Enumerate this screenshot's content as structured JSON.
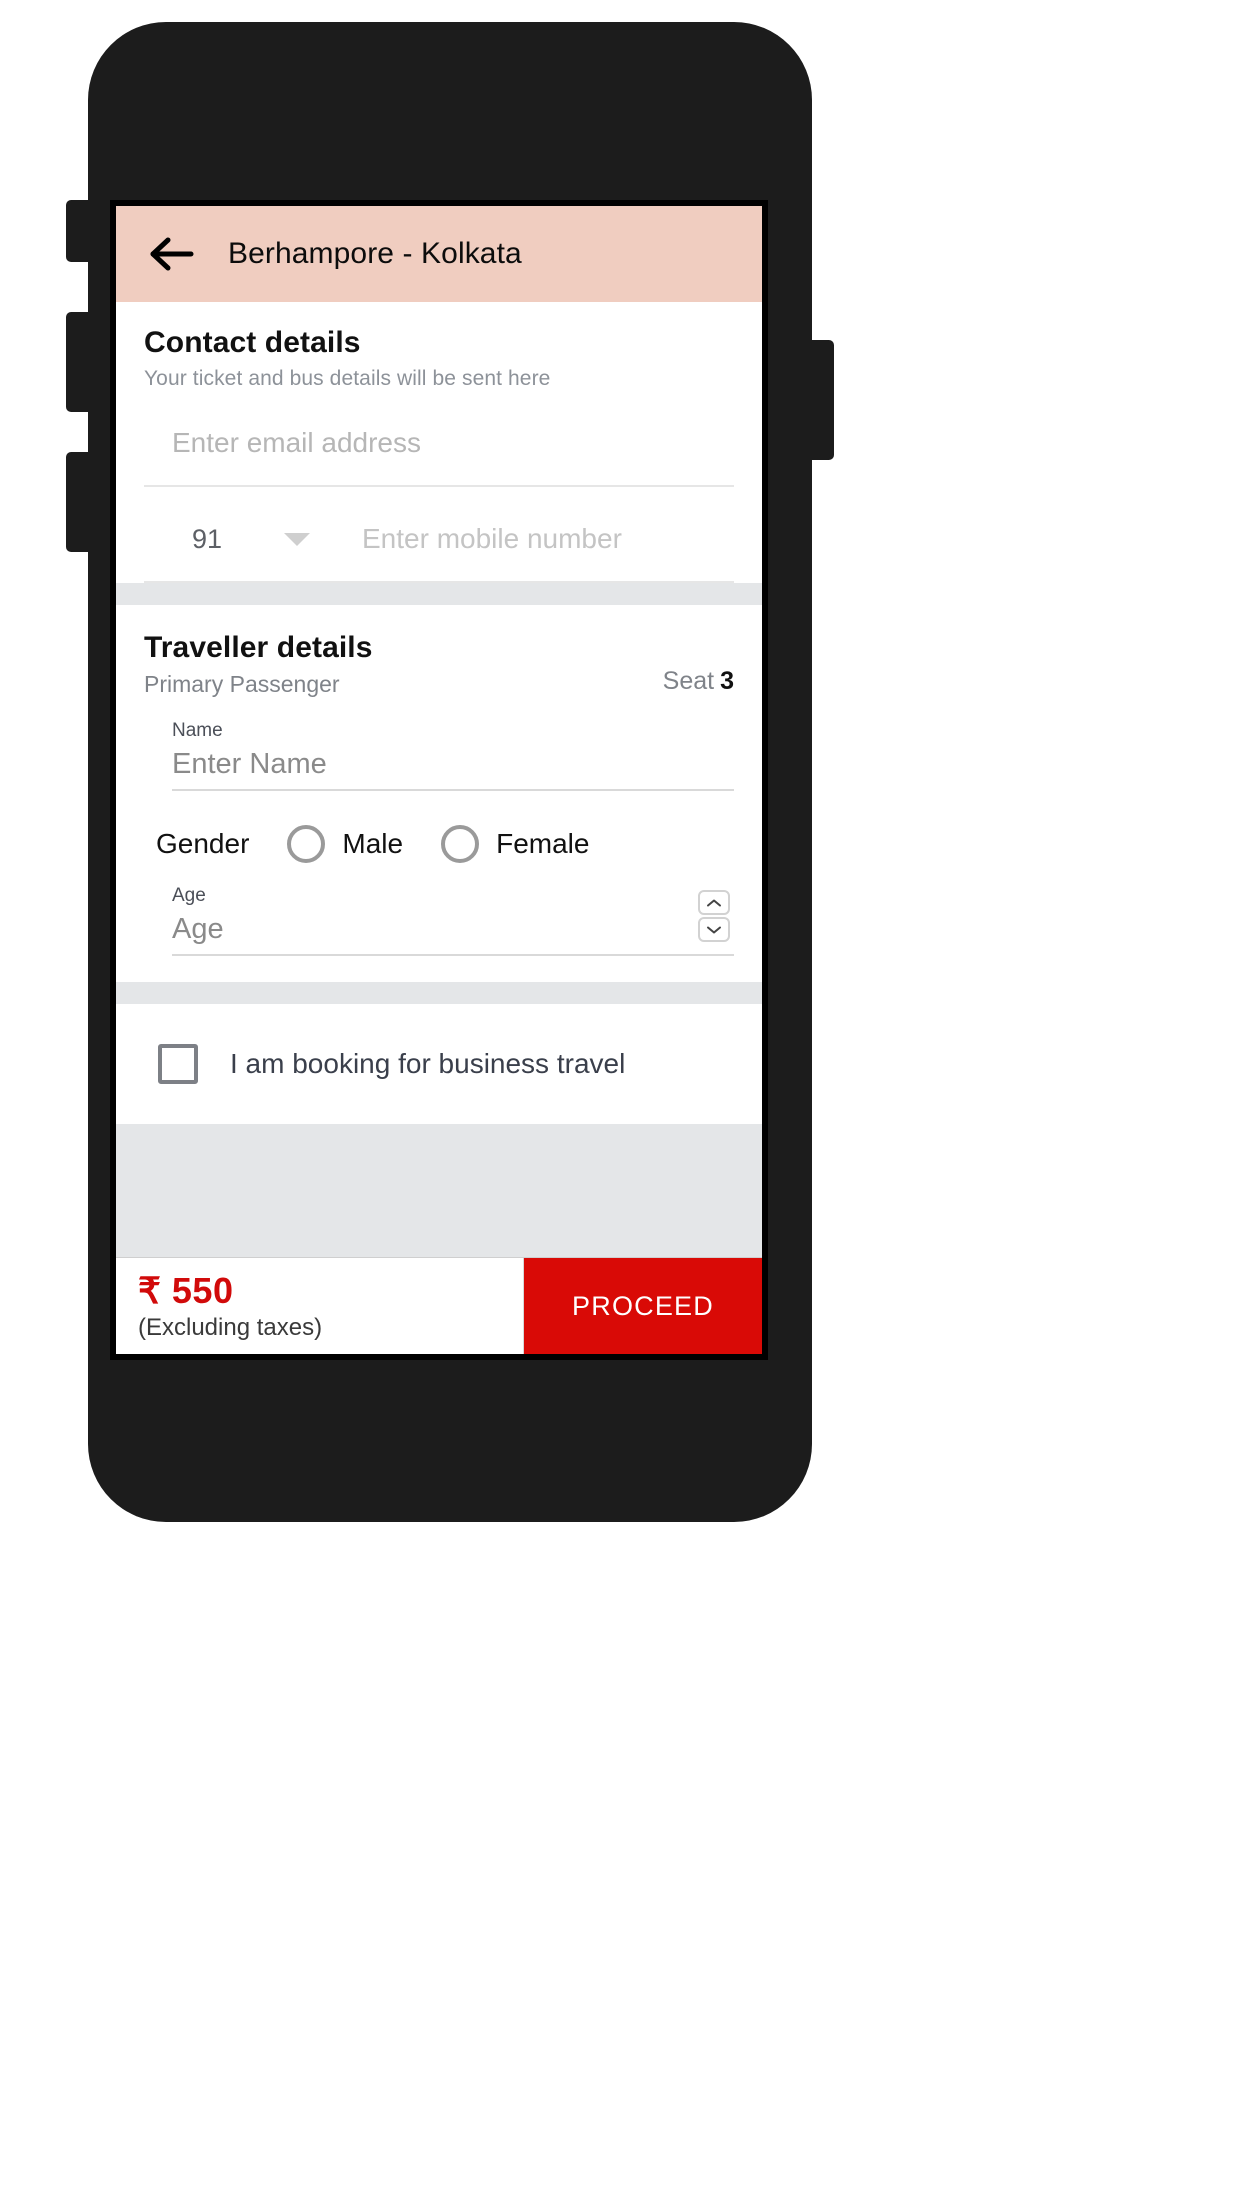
{
  "appbar": {
    "back_icon": "arrow-left-icon",
    "title": "Berhampore - Kolkata"
  },
  "contact": {
    "title": "Contact details",
    "subtitle": "Your ticket and bus details will be sent here",
    "email": {
      "value": "",
      "placeholder": "Enter email address"
    },
    "country_code": "91",
    "mobile": {
      "value": "",
      "placeholder": "Enter mobile number"
    }
  },
  "traveller": {
    "title": "Traveller details",
    "subtitle": "Primary Passenger",
    "seat_label": "Seat",
    "seat_number": "3",
    "name": {
      "label": "Name",
      "value": "",
      "placeholder": "Enter Name"
    },
    "gender": {
      "label": "Gender",
      "options": [
        "Male",
        "Female"
      ],
      "selected": ""
    },
    "age": {
      "label": "Age",
      "value": "",
      "placeholder": "Age"
    }
  },
  "business": {
    "label": "I am booking for business travel",
    "checked": false
  },
  "bottom": {
    "currency": "₹",
    "amount": "550",
    "price_text": "₹ 550",
    "tax_note": "(Excluding taxes)",
    "proceed_label": "PROCEED"
  },
  "colors": {
    "appbar": "#f0cdc0",
    "accent_red": "#d90a06",
    "price_red": "#d10a0a",
    "page_bg": "#e4e6e8",
    "phone_body": "#1c1c1c"
  }
}
